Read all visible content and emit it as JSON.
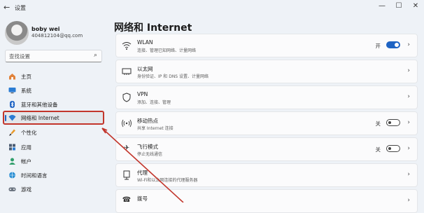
{
  "window": {
    "title": "设置",
    "controls": {
      "minimize": "—",
      "maximize": "☐",
      "close": "✕"
    }
  },
  "profile": {
    "name": "boby wei",
    "email": "404812104@qq.com"
  },
  "search": {
    "placeholder": "查找设置",
    "icon": "search-icon"
  },
  "sidebar": {
    "items": [
      {
        "label": "主页",
        "icon": "home-icon"
      },
      {
        "label": "系统",
        "icon": "monitor-icon"
      },
      {
        "label": "蓝牙和其他设备",
        "icon": "bluetooth-icon"
      },
      {
        "label": "网络和 Internet",
        "icon": "wifi-icon",
        "active": true
      },
      {
        "label": "个性化",
        "icon": "brush-icon"
      },
      {
        "label": "应用",
        "icon": "apps-icon"
      },
      {
        "label": "帐户",
        "icon": "account-icon"
      },
      {
        "label": "时间和语言",
        "icon": "globe-clock-icon"
      },
      {
        "label": "游戏",
        "icon": "gamepad-icon"
      }
    ]
  },
  "main": {
    "title": "网络和 Internet",
    "cards": [
      {
        "title": "WLAN",
        "desc": "连接、管理已知网络、计量网络",
        "icon": "wifi-icon",
        "toggle_label": "开",
        "toggle_on": true
      },
      {
        "title": "以太网",
        "desc": "身份验证、IP 和 DNS 设置、计量网络",
        "icon": "ethernet-icon"
      },
      {
        "title": "VPN",
        "desc": "添加、连接、管理",
        "icon": "shield-icon"
      },
      {
        "title": "移动热点",
        "desc": "共享 Internet 连接",
        "icon": "hotspot-icon",
        "toggle_label": "关",
        "toggle_on": false
      },
      {
        "title": "飞行模式",
        "desc": "停止无线通信",
        "icon": "airplane-icon",
        "toggle_label": "关",
        "toggle_on": false
      },
      {
        "title": "代理",
        "desc": "Wi-Fi和以太网连接的代理服务器",
        "icon": "proxy-icon"
      },
      {
        "title": "拨号",
        "desc": "",
        "icon": "phone-icon"
      }
    ]
  },
  "colors": {
    "accent": "#1e63c3",
    "highlight_border": "#c2352b",
    "annotation_arrow": "#c2352b"
  }
}
